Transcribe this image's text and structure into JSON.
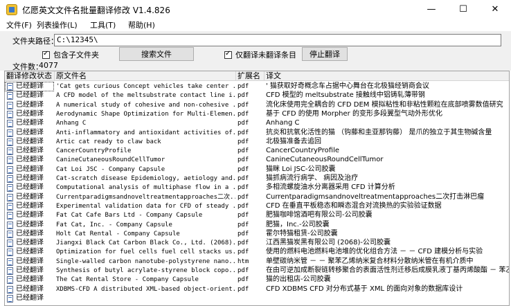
{
  "window": {
    "title": "亿愿英文文件名批量翻译修改 V1.4.826",
    "minimize": "—",
    "maximize": "☐",
    "close": "✕"
  },
  "menu": {
    "items": [
      "文件(F)",
      "列表操作(L)",
      "工具(T)",
      "帮助(H)"
    ]
  },
  "toolbar": {
    "folder_label": "文件夹路径：",
    "folder_value": "C:\\12345\\",
    "include_subfolders": "包含子文件夹",
    "search_button": "搜索文件",
    "only_untranslated": "仅翻译未翻译条目",
    "stop_button": "停止翻译",
    "file_count_label": "文件数：",
    "file_count": "4077"
  },
  "grid": {
    "columns": [
      "翻译修改状态",
      "原文件名",
      "扩展名",
      "译文"
    ],
    "rows": [
      {
        "status": "已经翻译",
        "name": "'Cat gets curious Concept vehicles take center ...",
        "ext": "pdf",
        "trans": "' 猫获取好奇概念车占据中心舞台在北极猫经销商会议"
      },
      {
        "status": "已经翻译",
        "name": "A CFD model of the meltsubstrate contact line i...",
        "ext": "pdf",
        "trans": "CFD 模型的 meltsubstrate 接触线中铝铸轧薄带钢"
      },
      {
        "status": "已经翻译",
        "name": "A numerical study of cohesive and non-cohesive ...",
        "ext": "pdf",
        "trans": "流化床使用完全耦合的 CFD DEM 模拟粘性和非粘性颗粒在底部喷雾数值研究"
      },
      {
        "status": "已经翻译",
        "name": "Aerodynamic Shape Optimization for Multi-Elemen...",
        "ext": "pdf",
        "trans": "基于 CFD 的使用 Morpher 的变形多段翼型气动外形优化"
      },
      {
        "status": "已经翻译",
        "name": "Anhang C",
        "ext": "pdf",
        "trans": "Anhang C"
      },
      {
        "status": "已经翻译",
        "name": "Anti-inflammatory and antioxidant activities of...",
        "ext": "pdf",
        "trans": "抗炎和抗氧化活性的猫 （钩藤和圭亚那钩藤） 是爪的独立于其生物碱含量"
      },
      {
        "status": "已经翻译",
        "name": "Artic cat ready to claw back",
        "ext": "pdf",
        "trans": "北极猫准备去追回"
      },
      {
        "status": "已经翻译",
        "name": "CancerCountryProfile",
        "ext": "pdf",
        "trans": "CancerCountryProfile"
      },
      {
        "status": "已经翻译",
        "name": "CanineCutaneousRoundCellTumor",
        "ext": "pdf",
        "trans": "CanineCutaneousRoundCellTumor"
      },
      {
        "status": "已经翻译",
        "name": "Cat Loi JSC - Company Capsule",
        "ext": "pdf",
        "trans": "猫眯 Loi JSC-公司胶囊"
      },
      {
        "status": "已经翻译",
        "name": "Cat-scratch disease Epidemiology, aetiology and...",
        "ext": "pdf",
        "trans": "猫抓病流行病学、 病因及治疗"
      },
      {
        "status": "已经翻译",
        "name": "Computational analysis of multiphase flow in a ...",
        "ext": "pdf",
        "trans": "多相流螺旋油水分离器采用 CFD 计算分析"
      },
      {
        "status": "已经翻译",
        "name": "Currentparadigmsandnoveltreatmentapproaches二次...",
        "ext": "pdf",
        "trans": "Currentparadigmsandnoveltreatmentapproaches二次打击淋巴瘤"
      },
      {
        "status": "已经翻译",
        "name": "Experimental validation data for CFD of steady ...",
        "ext": "pdf",
        "trans": "CFD 在垂直平板稳态和瞬态混合对流换热的实验验证数据"
      },
      {
        "status": "已经翻译",
        "name": "Fat Cat Cafe Bars Ltd - Company Capsule",
        "ext": "pdf",
        "trans": "肥猫咖啡馆酒吧有限公司-公司胶囊"
      },
      {
        "status": "已经翻译",
        "name": "Fat Cat, Inc. - Company Capsule",
        "ext": "pdf",
        "trans": "肥猫，Inc.-公司胶囊"
      },
      {
        "status": "已经翻译",
        "name": "Holt Cat Rental - Company Capsule",
        "ext": "pdf",
        "trans": "霍尔特猫租赁-公司胶囊"
      },
      {
        "status": "已经翻译",
        "name": "Jiangxi Black Cat Carbon Black Co., Ltd. (2068)...",
        "ext": "pdf",
        "trans": "江西黑猫炭黑有限公司 (2068)-公司胶囊"
      },
      {
        "status": "已经翻译",
        "name": "Optimization for fuel cells fuel cell stacks us...",
        "ext": "pdf",
        "trans": "使用的燃料电池燃料电池堆的优化组合方法 － － CFD 建模分析与实验"
      },
      {
        "status": "已经翻译",
        "name": "Single-walled carbon nanotube-polystyrene nano...",
        "ext": "htm",
        "trans": "单壁碳纳米管 － － 聚苯乙烯纳米复合材料分散纳米管在有机介质中"
      },
      {
        "status": "已经翻译",
        "name": "Synthesis of butyl acrylate-styrene block copo...",
        "ext": "pdf",
        "trans": "在由可逆加成断裂链转移聚合的表面活性剂迁移后成膜乳液丁基丙烯酸酯 － 苯乙"
      },
      {
        "status": "已经翻译",
        "name": "The Cat Rental Store - Company Capsule",
        "ext": "pdf",
        "trans": "猫的出租店-公司胶囊"
      },
      {
        "status": "已经翻译",
        "name": "XDBMS-CFD A distributed XML-based object-orient...",
        "ext": "pdf",
        "trans": "CFD XDBMS CFD 对分布式基于 XML 的面向对象的数据库设计"
      },
      {
        "status": "已经翻译",
        "name": "",
        "ext": "",
        "trans": ""
      }
    ]
  }
}
